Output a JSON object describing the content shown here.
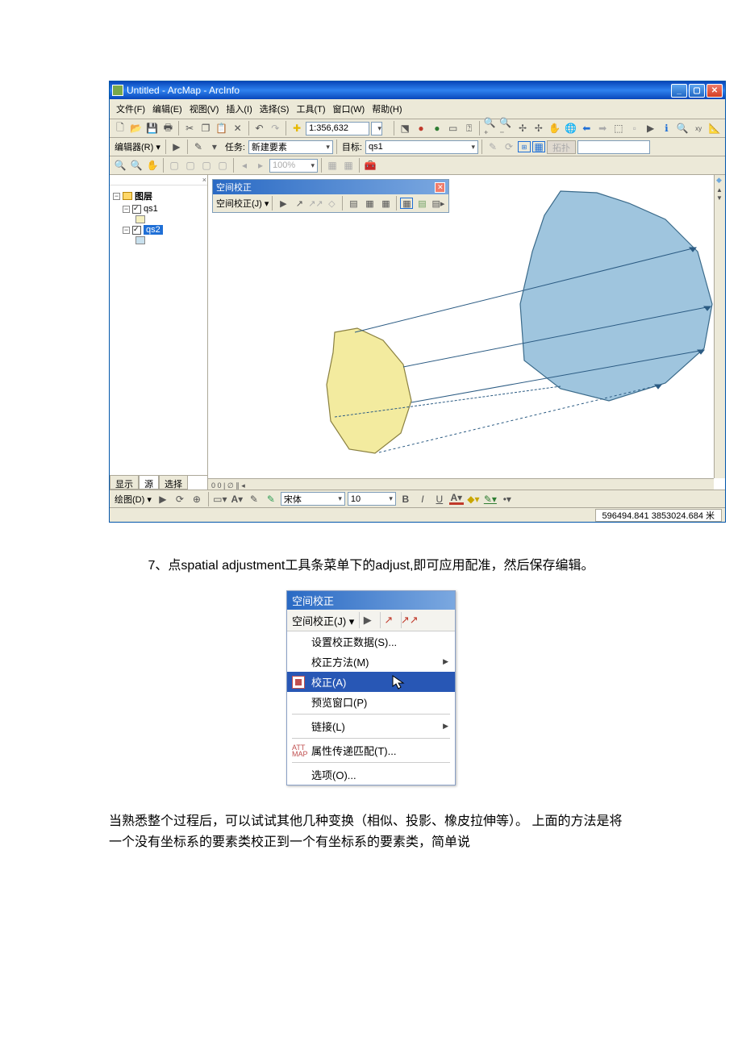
{
  "arcmap": {
    "title": "Untitled - ArcMap - ArcInfo",
    "menubar": {
      "file": "文件(F)",
      "edit": "编辑(E)",
      "view": "视图(V)",
      "insert": "插入(I)",
      "select": "选择(S)",
      "tools": "工具(T)",
      "window": "窗口(W)",
      "help": "帮助(H)"
    },
    "scale_value": "1:356,632",
    "editor_label": "编辑器(R) ▾",
    "task_label": "任务:",
    "task_value": "新建要素",
    "target_label": "目标:",
    "target_value": "qs1",
    "extend_label": "拓扑",
    "zoom": "100%",
    "toc": {
      "root": "图层",
      "layer1": "qs1",
      "layer2": "qs2",
      "tab_display": "显示",
      "tab_source": "源",
      "tab_select": "选择"
    },
    "floating_toolbar": {
      "title": "空间校正",
      "label": "空间校正(J) ▾"
    },
    "drawing_label": "绘图(D) ▾",
    "font": "宋体",
    "font_size": "10",
    "status_coords": "596494.841 3853024.684 米",
    "scroll_bottom_view": "0 0  |  ∅ ∥  ◂"
  },
  "doc": {
    "para1": "7、点spatial adjustment工具条菜单下的adjust,即可应用配准，然后保存编辑。",
    "para2": "当熟悉整个过程后，可以试试其他几种变换（相似、投影、橡皮拉伸等）。 上面的方法是将一个没有坐标系的要素类校正到一个有坐标系的要素类，简单说"
  },
  "menu": {
    "title": "空间校正",
    "strip_label": "空间校正(J) ▾",
    "items": {
      "set_data": "设置校正数据(S)...",
      "method": "校正方法(M)",
      "adjust": "校正(A)",
      "preview": "预览窗口(P)",
      "links": "链接(L)",
      "attr": "属性传递匹配(T)...",
      "options": "选项(O)..."
    },
    "attr_icon_text": "ATT\nMAP"
  }
}
